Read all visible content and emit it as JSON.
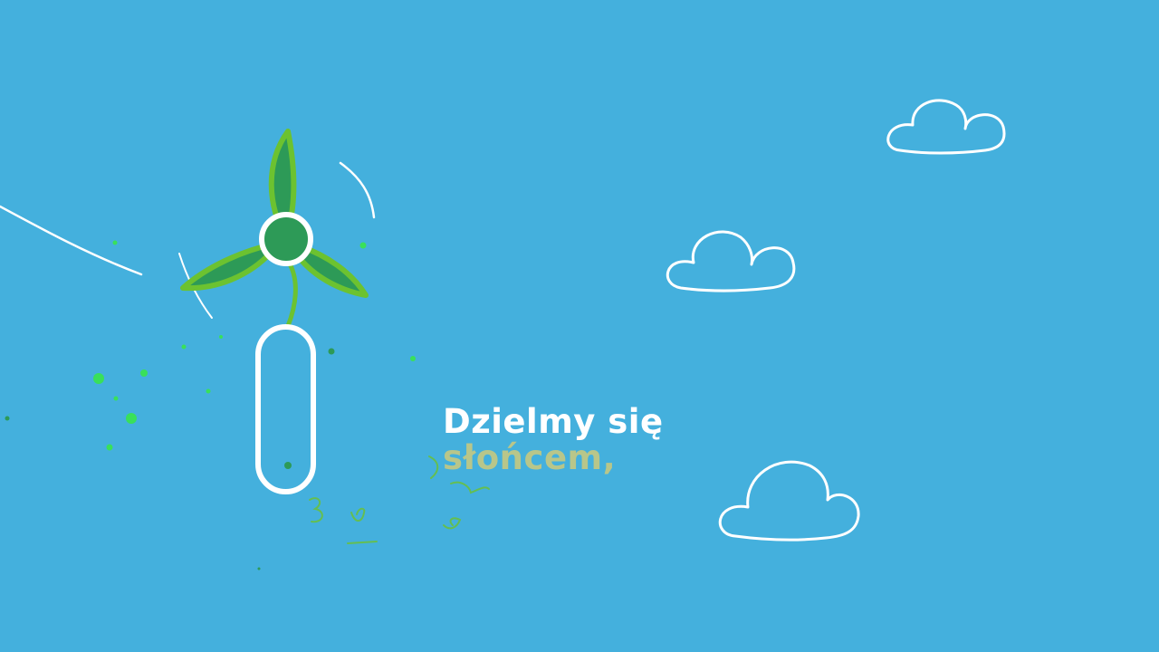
{
  "caption": {
    "line1": "Dzielmy się",
    "line2": "słońcem,"
  },
  "colors": {
    "sky": "#44b0dd",
    "outline": "#ffffff",
    "blade_fill": "#2d9a57",
    "blade_stroke": "#6cc230",
    "hub_fill": "#2d9a57",
    "caption_primary": "#ffffff",
    "caption_accent": "#b8c68a",
    "particle": "#39e05a"
  },
  "icons": [
    "wind-turbine-icon",
    "cloud-icon"
  ]
}
